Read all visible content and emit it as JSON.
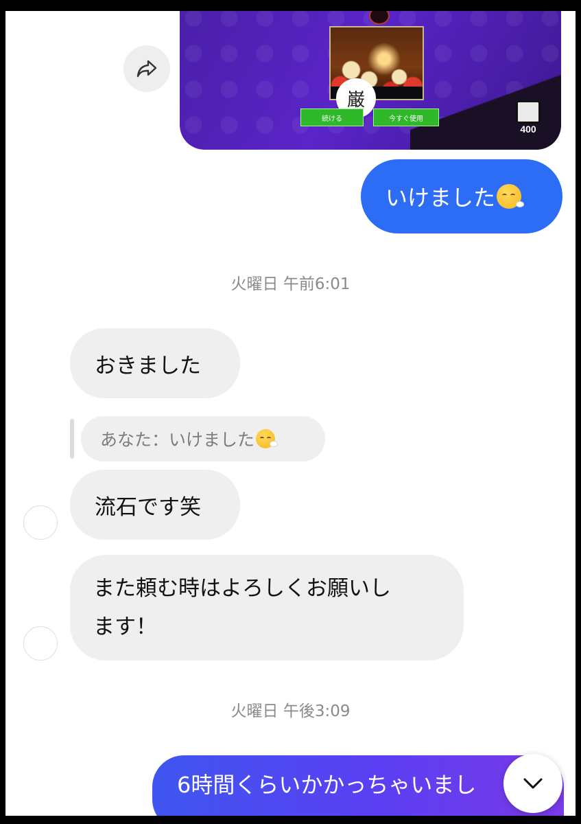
{
  "shared_image": {
    "stamp_char": "巌",
    "button_left": "続ける",
    "button_right": "今すぐ使用",
    "prize_count": "400"
  },
  "messages": {
    "out_1": "いけました",
    "timestamp_1": "火曜日 午前6:01",
    "in_1": "おきました",
    "reply_quote": "あなた：いけました",
    "in_2": "流石です笑",
    "in_3_line1": "また頼む時はよろしくお願いし",
    "in_3_line2": "ます！",
    "timestamp_2": "火曜日 午後3:09",
    "out_2": "6時間くらいかかっちゃいまし"
  },
  "icons": {
    "share": "share-arrow-icon",
    "scroll": "chevron-down-icon",
    "emoji": "face-exhaling-emoji"
  },
  "colors": {
    "outgoing_bubble": "#2d6df6",
    "incoming_bubble": "#efeff0",
    "timestamp_text": "#8a8a8e"
  }
}
